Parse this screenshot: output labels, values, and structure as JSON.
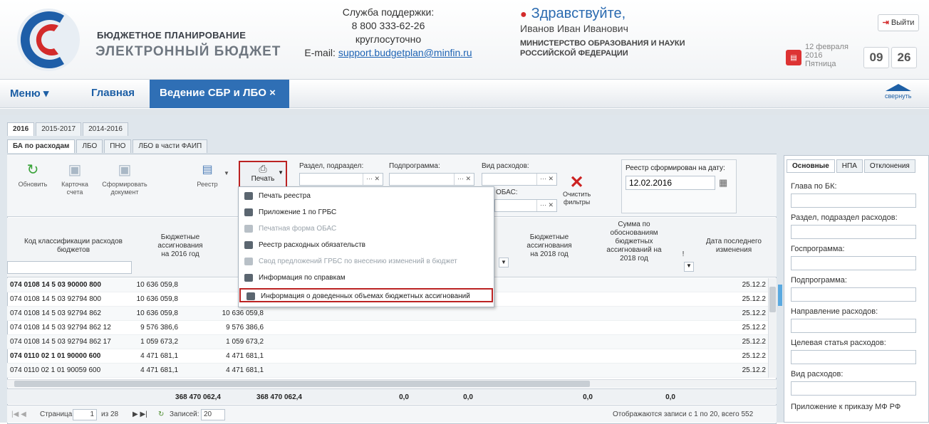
{
  "header": {
    "brand_line1": "БЮДЖЕТНОЕ ПЛАНИРОВАНИЕ",
    "brand_line2": "ЭЛЕКТРОННЫЙ БЮДЖЕТ",
    "support_title": "Служба поддержки:",
    "support_phone": "8 800 333-62-26",
    "support_hours": "круглосуточно",
    "support_email_label": "E-mail: ",
    "support_email": "support.budgetplan@minfin.ru",
    "greeting": "Здравствуйте,",
    "user_name": "Иванов Иван Иванович",
    "org_line1": "МИНИСТЕРСТВО ОБРАЗОВАНИЯ И НАУКИ",
    "org_line2": "РОССИЙСКОЙ ФЕДЕРАЦИИ",
    "logout": "Выйти",
    "date_line1": "12 февраля",
    "date_line2": "2016",
    "date_line3": "Пятница",
    "hours": "09",
    "minutes": "26"
  },
  "nav": {
    "menu": "Меню ▾",
    "home": "Главная",
    "active_tab": "Ведение СБР и ЛБО ×",
    "collapse": "свернуть"
  },
  "year_tabs": [
    "2016",
    "2015-2017",
    "2014-2016"
  ],
  "sub_tabs": [
    "БА по расходам",
    "ЛБО",
    "ПНО",
    "ЛБО в части ФАИП"
  ],
  "toolbar": {
    "refresh": "Обновить",
    "card": "Карточка",
    "card2": "счета",
    "form": "Сформировать",
    "form2": "документ",
    "registry": "Реестр",
    "print": "Печать",
    "section_label": "Раздел, подраздел:",
    "subprogram_label": "Подпрограмма:",
    "exp_type_label": "Вид расходов:",
    "obas_label": "ОБАС:",
    "clear": "Очистить",
    "clear2": "фильтры",
    "reg_date_label": "Реестр сформирован на дату:",
    "reg_date": "12.02.2016"
  },
  "grid": {
    "h_code": "Код классификации расходов бюджетов",
    "h_ba2016a": "Бюджетные",
    "h_ba2016b": "ассигнования",
    "h_ba2016c": "на 2016 год",
    "h_ba2018a": "Бюджетные",
    "h_ba2018b": "ассигнования",
    "h_ba2018c": "на 2018 год",
    "h_suma": "Сумма по",
    "h_sumb": "обоснованиям",
    "h_sumc": "бюджетных",
    "h_sumd": "ассигнований на",
    "h_sume": "2018 год",
    "h_datea": "Дата последнего",
    "h_dateb": "изменения",
    "rows": [
      {
        "code": "074 0108 14 5 03 90000 800",
        "v1": "10 636 059,8",
        "v2": "",
        "date": "25.12.2"
      },
      {
        "code": "074 0108 14 5 03 92794 800",
        "v1": "10 636 059,8",
        "v2": "",
        "date": "25.12.2"
      },
      {
        "code": "074 0108 14 5 03 92794 862",
        "v1": "10 636 059,8",
        "v2": "10 636 059,8",
        "date": "25.12.2"
      },
      {
        "code": "074 0108 14 5 03 92794 862 12",
        "v1": "9 576 386,6",
        "v2": "9 576 386,6",
        "date": "25.12.2"
      },
      {
        "code": "074 0108 14 5 03 92794 862 17",
        "v1": "1 059 673,2",
        "v2": "1 059 673,2",
        "date": "25.12.2"
      },
      {
        "code": "074 0110 02 1 01 90000 600",
        "v1": "4 471 681,1",
        "v2": "4 471 681,1",
        "date": "25.12.2"
      },
      {
        "code": "074 0110 02 1 01 90059 600",
        "v1": "4 471 681,1",
        "v2": "4 471 681,1",
        "date": "25.12.2"
      }
    ],
    "total1": "368 470 062,4",
    "total2": "368 470 062,4",
    "total3": "0,0",
    "total4": "0,0",
    "total5": "0,0",
    "total6": "0,0"
  },
  "pager": {
    "page_label": "Страница",
    "page": "1",
    "of": "из 28",
    "records_label": "Записей:",
    "records": "20",
    "info": "Отображаются записи с 1 по 20, всего 552"
  },
  "print_menu": [
    {
      "label": "Печать реестра",
      "disabled": false
    },
    {
      "label": "Приложение 1 по ГРБС",
      "disabled": false
    },
    {
      "label": "Печатная форма ОБАС",
      "disabled": true
    },
    {
      "label": "Реестр расходных обязательств",
      "disabled": false
    },
    {
      "label": "Свод предложений ГРБС по внесению изменений в бюджет",
      "disabled": true
    },
    {
      "label": "Информация по справкам",
      "disabled": false
    },
    {
      "label": "Информация о доведенных объемах бюджетных ассигнований",
      "disabled": false
    }
  ],
  "side": {
    "tabs": [
      "Основные",
      "НПА",
      "Отклонения"
    ],
    "f1": "Глава по БК:",
    "f2": "Раздел, подраздел расходов:",
    "f3": "Госпрограмма:",
    "f4": "Подпрограмма:",
    "f5": "Направление расходов:",
    "f6": "Целевая статья расходов:",
    "f7": "Вид расходов:",
    "f8": "Приложение к приказу МФ РФ"
  },
  "colors": {
    "accent": "#2f6fb5",
    "highlight": "#b22222"
  }
}
